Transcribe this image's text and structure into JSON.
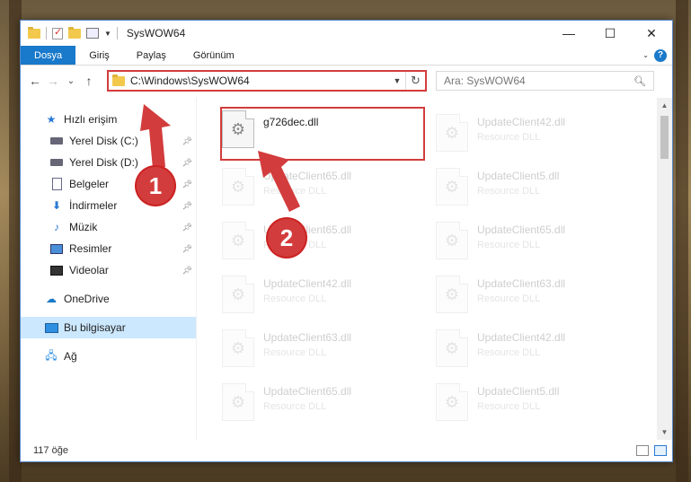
{
  "window": {
    "title": "SysWOW64",
    "controls": {
      "minimize": "—",
      "maximize": "☐",
      "close": "✕"
    }
  },
  "ribbon": {
    "tabs": [
      {
        "label": "Dosya",
        "active": true
      },
      {
        "label": "Giriş",
        "active": false
      },
      {
        "label": "Paylaş",
        "active": false
      },
      {
        "label": "Görünüm",
        "active": false
      }
    ],
    "help": "?"
  },
  "nav": {
    "back": "←",
    "forward": "→",
    "recent": "⌄",
    "up": "↑",
    "address": "C:\\Windows\\SysWOW64",
    "refresh": "↻",
    "search_placeholder": "Ara: SysWOW64"
  },
  "sidebar": {
    "quick_access": "Hızlı erişim",
    "items": [
      {
        "label": "Yerel Disk (C:)",
        "icon": "drive-icon"
      },
      {
        "label": "Yerel Disk (D:)",
        "icon": "drive-icon"
      },
      {
        "label": "Belgeler",
        "icon": "documents-icon"
      },
      {
        "label": "İndirmeler",
        "icon": "downloads-icon"
      },
      {
        "label": "Müzik",
        "icon": "music-icon"
      },
      {
        "label": "Resimler",
        "icon": "pictures-icon"
      },
      {
        "label": "Videolar",
        "icon": "videos-icon"
      }
    ],
    "onedrive": "OneDrive",
    "this_pc": "Bu bilgisayar",
    "network": "Ağ"
  },
  "files": [
    {
      "name": "g726dec.dll",
      "type": "",
      "highlighted": true
    },
    {
      "name": "UpdateClient42.dll",
      "type": "Resource DLL"
    },
    {
      "name": "UpdateClient65.dll",
      "type": "Resource DLL"
    },
    {
      "name": "UpdateClient5.dll",
      "type": "Resource DLL"
    },
    {
      "name": "UpdateClient65.dll",
      "type": "Resource DLL"
    },
    {
      "name": "UpdateClient65.dll",
      "type": "Resource DLL"
    },
    {
      "name": "UpdateClient42.dll",
      "type": "Resource DLL"
    },
    {
      "name": "UpdateClient63.dll",
      "type": "Resource DLL"
    },
    {
      "name": "UpdateClient63.dll",
      "type": "Resource DLL"
    },
    {
      "name": "UpdateClient42.dll",
      "type": "Resource DLL"
    },
    {
      "name": "UpdateClient65.dll",
      "type": "Resource DLL"
    },
    {
      "name": "UpdateClient5.dll",
      "type": "Resource DLL"
    }
  ],
  "status": {
    "count": "117 öğe"
  },
  "annotations": {
    "step1": "1",
    "step2": "2",
    "color": "#d33c3c"
  }
}
